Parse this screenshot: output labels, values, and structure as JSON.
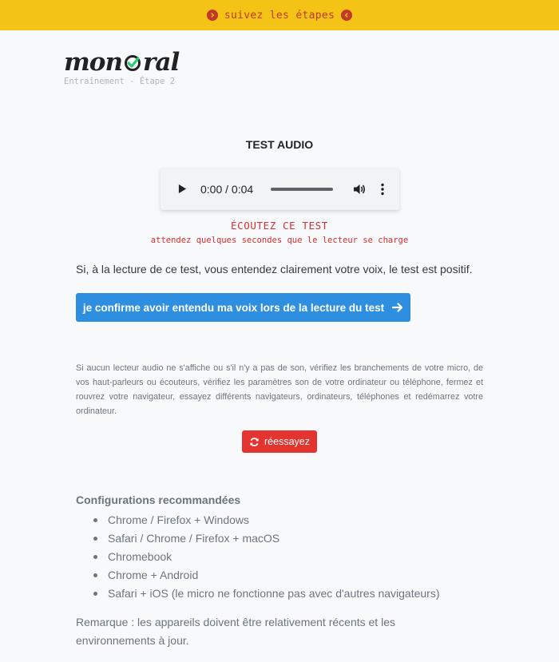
{
  "banner": {
    "label": "suivez les étapes",
    "left_icon": "chevron-circle-right-icon",
    "right_icon": "chevron-circle-left-icon",
    "color": "#c0392b",
    "background": "#f3c316"
  },
  "logo": {
    "text_before": "mon ",
    "text_after": "ral",
    "subtitle": "Entraînement - Étape 2"
  },
  "page": {
    "title": "TEST AUDIO"
  },
  "player": {
    "time": "0:00 / 0:04"
  },
  "listen": {
    "heading": "ÉCOUTEZ CE TEST",
    "note": "attendez quelques secondes que le lecteur se charge"
  },
  "intro": "Si, à la lecture de ce test, vous entendez clairement votre voix, le test est positif.",
  "confirm_button": {
    "label": "je confirme avoir entendu ma voix lors de la lecture du test",
    "icon": "arrow-right-icon",
    "color": "#2e8fe0"
  },
  "help_text": "Si aucun lecteur audio ne s'affiche ou s'il n'y a pas de son, vérifiez les branchements de votre micro, de vos haut-parleurs ou écouteurs, vérifiez les paramètres son de votre ordinateur ou téléphone, fermez et rouvrez votre navigateur, essayez différents navigateurs, ordinateurs, téléphones et redémarrez votre ordinateur.",
  "retry_button": {
    "label": "réessayez",
    "icon": "refresh-icon",
    "color": "#e3342f"
  },
  "configs": {
    "heading": "Configurations recommandées",
    "items": [
      "Chrome / Firefox + Windows",
      "Safari / Chrome / Firefox + macOS",
      "Chromebook",
      "Chrome + Android",
      "Safari + iOS (le micro ne fonctionne pas avec d'autres navigateurs)"
    ]
  },
  "remark": "Remarque : les appareils doivent être relativement récents et les environnements à jour."
}
